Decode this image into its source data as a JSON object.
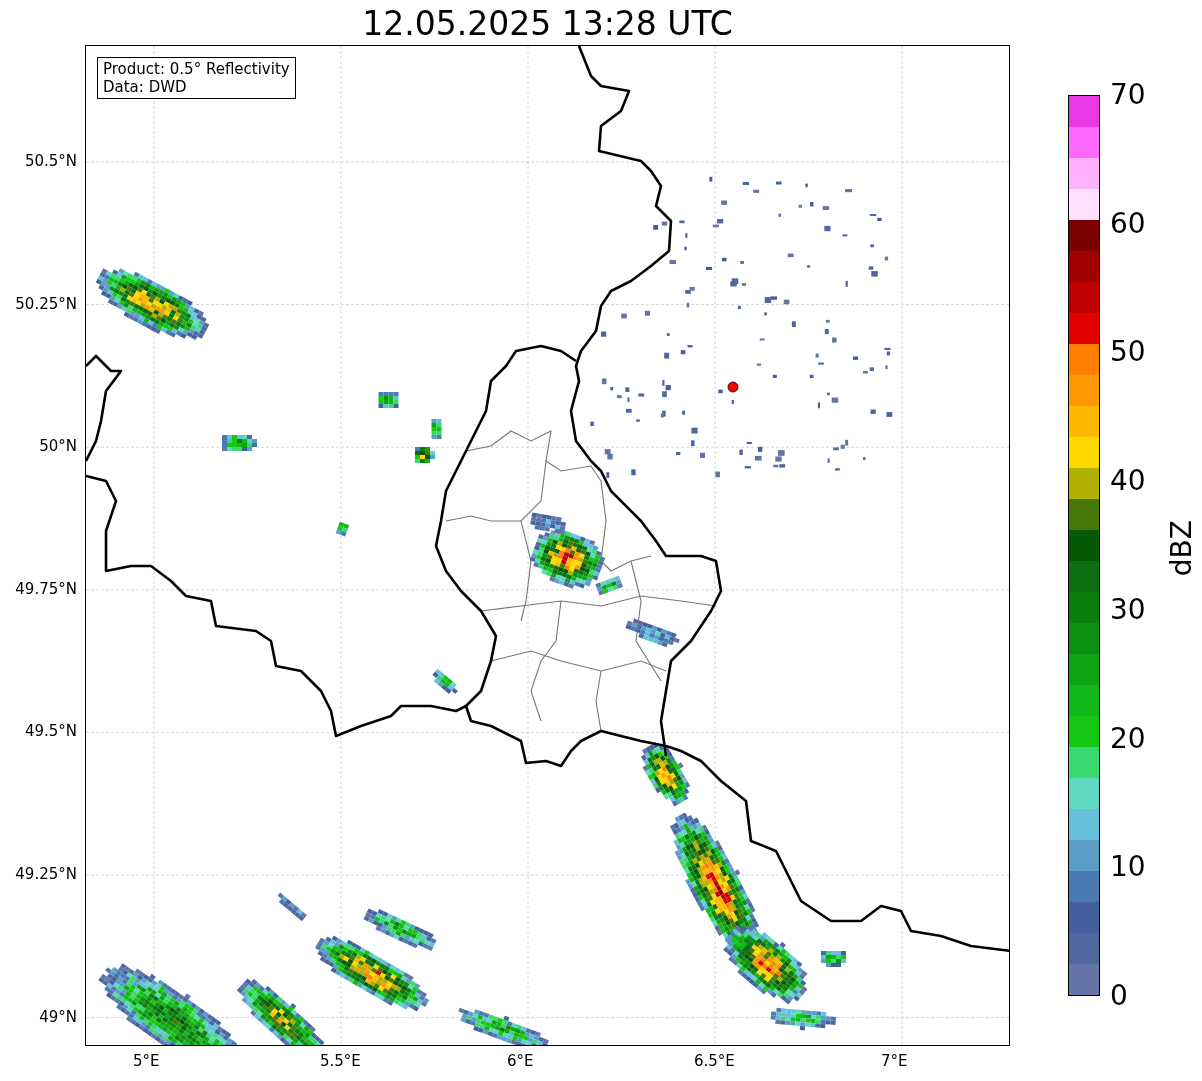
{
  "title": "12.05.2025 13:28 UTC",
  "map": {
    "legend": [
      "Product: 0.5° Reflectivity",
      "Data: DWD"
    ],
    "x_ticks": [
      "5°E",
      "5.5°E",
      "6°E",
      "6.5°E",
      "7°E"
    ],
    "y_ticks": [
      "50.5°N",
      "50.25°N",
      "50°N",
      "49.75°N",
      "49.5°N",
      "49.25°N",
      "49°N"
    ]
  },
  "colorbar": {
    "label": "dBZ",
    "ticks": [
      "70",
      "60",
      "50",
      "40",
      "30",
      "20",
      "10",
      "0"
    ],
    "bands": [
      {
        "color": "#e838e8"
      },
      {
        "color": "#ff68ff"
      },
      {
        "color": "#ffb0ff"
      },
      {
        "color": "#ffe0ff"
      },
      {
        "color": "#7a0000"
      },
      {
        "color": "#a00000"
      },
      {
        "color": "#c00000"
      },
      {
        "color": "#e00000"
      },
      {
        "color": "#ff8000"
      },
      {
        "color": "#ff9800"
      },
      {
        "color": "#ffb800"
      },
      {
        "color": "#ffd800"
      },
      {
        "color": "#b0b000"
      },
      {
        "color": "#487808"
      },
      {
        "color": "#065a06"
      },
      {
        "color": "#0c7010"
      },
      {
        "color": "#0a7e0c"
      },
      {
        "color": "#0c9010"
      },
      {
        "color": "#10a414"
      },
      {
        "color": "#12b818"
      },
      {
        "color": "#14c814"
      },
      {
        "color": "#3cd870"
      },
      {
        "color": "#5ed8c0"
      },
      {
        "color": "#66c0dc"
      },
      {
        "color": "#5a9ec8"
      },
      {
        "color": "#4a7ab4"
      },
      {
        "color": "#4460a0"
      },
      {
        "color": "#5068a0"
      },
      {
        "color": "#6474a6"
      }
    ]
  }
}
